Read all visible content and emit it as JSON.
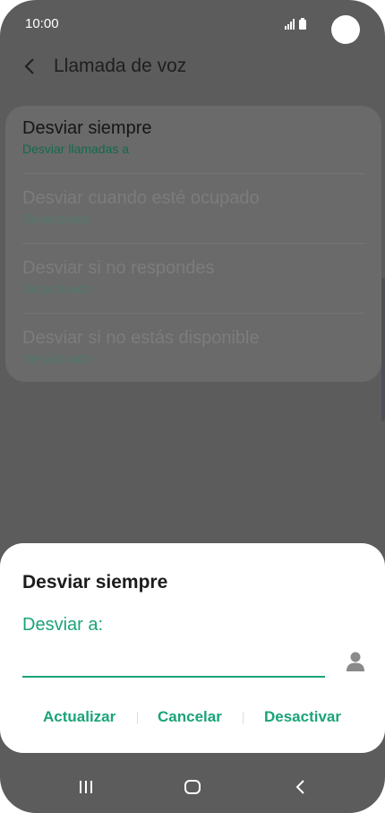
{
  "status": {
    "time": "10:00"
  },
  "appbar": {
    "title": "Llamada de voz"
  },
  "list": [
    {
      "title": "Desviar siempre",
      "sub": "Desviar llamadas a"
    },
    {
      "title": "Desviar cuando esté ocupado",
      "sub": "Desactivado"
    },
    {
      "title": "Desviar si no respondes",
      "sub": "Desactivado"
    },
    {
      "title": "Desviar si no estás disponible",
      "sub": "Desactivado"
    }
  ],
  "dialog": {
    "title": "Desviar siempre",
    "label": "Desviar a:",
    "value": "",
    "buttons": {
      "update": "Actualizar",
      "cancel": "Cancelar",
      "disable": "Desactivar"
    }
  },
  "colors": {
    "accent": "#1aa37a",
    "overlay": "#5c5c5c"
  }
}
